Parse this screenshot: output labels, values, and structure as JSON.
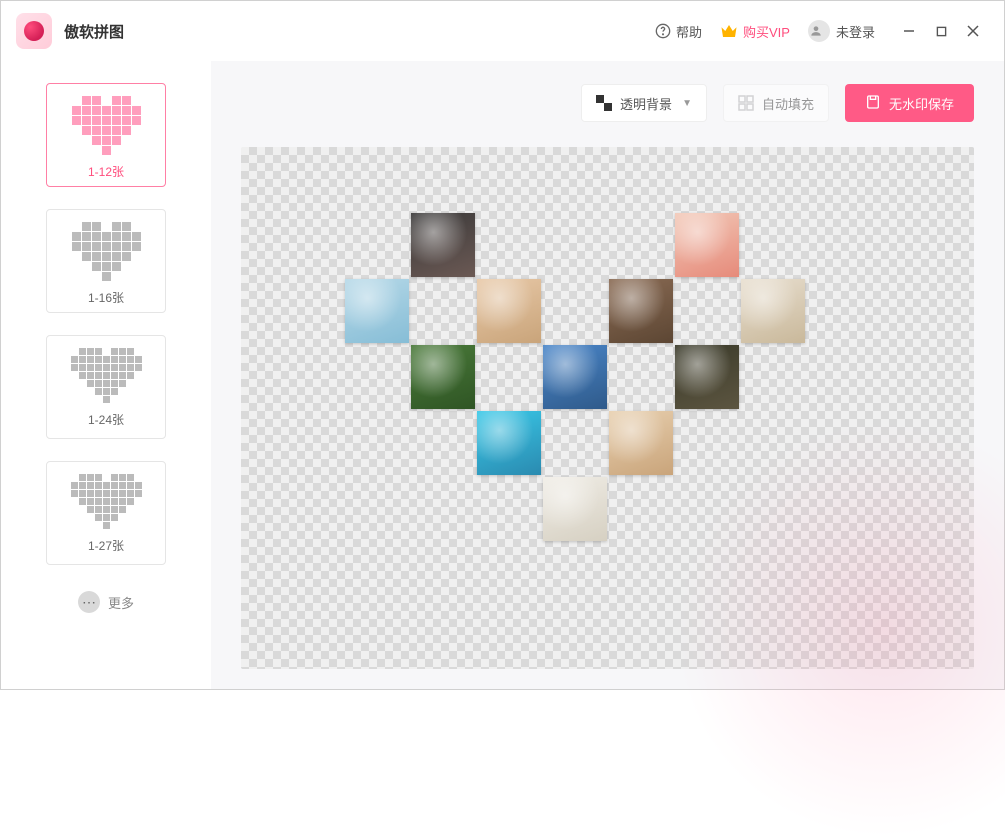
{
  "app": {
    "title": "傲软拼图"
  },
  "header": {
    "help": "帮助",
    "vip": "购买VIP",
    "login": "未登录"
  },
  "sidebar": {
    "templates": [
      {
        "label": "1-12张",
        "cols": 7,
        "active": true
      },
      {
        "label": "1-16张",
        "cols": 7,
        "active": false
      },
      {
        "label": "1-24张",
        "cols": 9,
        "active": false
      },
      {
        "label": "1-27张",
        "cols": 9,
        "active": false
      }
    ],
    "more": "更多"
  },
  "toolbar": {
    "background": "透明背景",
    "autofill": "自动填充",
    "save": "无水印保存"
  },
  "canvas": {
    "slot_count": 12
  }
}
